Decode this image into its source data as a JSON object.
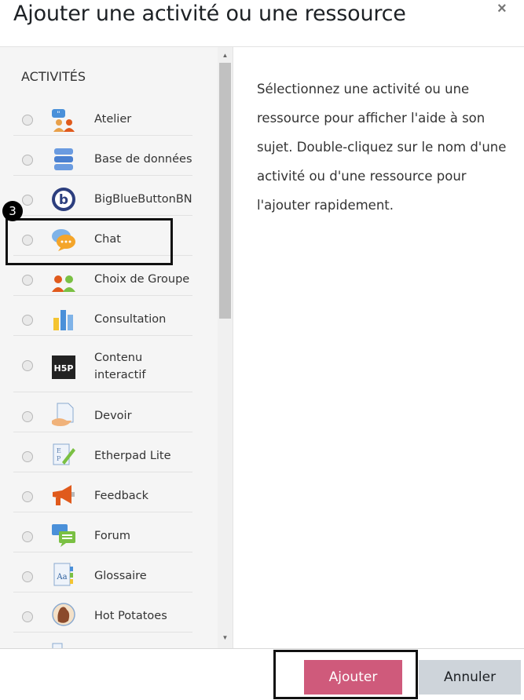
{
  "dialog": {
    "title": "Ajouter une activité ou une ressource",
    "close_glyph": "×"
  },
  "activities": {
    "section_label": "ACTIVITÉS",
    "items": [
      {
        "label": "Atelier",
        "icon": "workshop-icon"
      },
      {
        "label": "Base de données",
        "icon": "database-icon"
      },
      {
        "label": "BigBlueButtonBN",
        "icon": "bigbluebutton-icon"
      },
      {
        "label": "Chat",
        "icon": "chat-icon"
      },
      {
        "label": "Choix de Groupe",
        "icon": "group-choice-icon"
      },
      {
        "label": "Consultation",
        "icon": "consultation-icon"
      },
      {
        "label": "Contenu interactif",
        "icon": "h5p-icon"
      },
      {
        "label": "Devoir",
        "icon": "assignment-icon"
      },
      {
        "label": "Etherpad Lite",
        "icon": "etherpad-icon"
      },
      {
        "label": "Feedback",
        "icon": "feedback-icon"
      },
      {
        "label": "Forum",
        "icon": "forum-icon"
      },
      {
        "label": "Glossaire",
        "icon": "glossary-icon"
      },
      {
        "label": "Hot Potatoes",
        "icon": "hot-potatoes-icon"
      }
    ]
  },
  "help": {
    "text": "Sélectionnez une activité ou une ressource pour afficher l'aide à son sujet. Double-cliquez sur le nom d'une activité ou d'une ressource pour l'ajouter rapidement."
  },
  "footer": {
    "add_label": "Ajouter",
    "cancel_label": "Annuler"
  },
  "annotation": {
    "step_number": "3"
  },
  "colors": {
    "primary": "#cf5a7b",
    "secondary": "#ced4da",
    "left_pane_bg": "#f5f5f5"
  }
}
